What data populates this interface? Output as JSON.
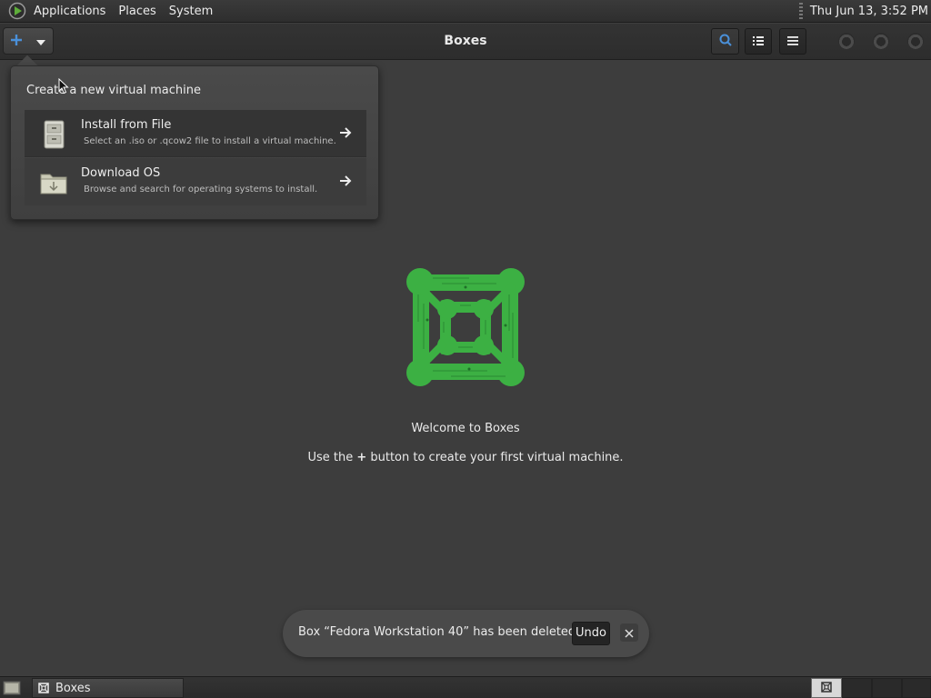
{
  "top_panel": {
    "menus": [
      "Applications",
      "Places",
      "System"
    ],
    "clock": "Thu Jun 13,  3:52 PM"
  },
  "header": {
    "title": "Boxes",
    "icons": [
      "new-plus-icon",
      "chevron-down-icon",
      "search-icon",
      "list-view-icon",
      "hamburger-menu-icon"
    ]
  },
  "popover": {
    "title": "Create a new virtual machine",
    "items": [
      {
        "title": "Install from File",
        "subtitle": "Select an .iso or .qcow2 file to install a virtual machine.",
        "icon": "file-cabinet-icon"
      },
      {
        "title": "Download OS",
        "subtitle": "Browse and search for operating systems to install.",
        "icon": "download-folder-icon"
      }
    ]
  },
  "welcome": {
    "title": "Welcome to Boxes",
    "sub_before": "Use the ",
    "sub_plus": "+",
    "sub_after": " button to create your first virtual machine."
  },
  "toast": {
    "message": "Box “Fedora Workstation 40” has been deleted",
    "undo_label": "Undo"
  },
  "taskbar": {
    "window_label": "Boxes"
  },
  "colors": {
    "accent": "#4a90d9",
    "logo_green": "#3cb043",
    "background": "#3d3d3d"
  }
}
